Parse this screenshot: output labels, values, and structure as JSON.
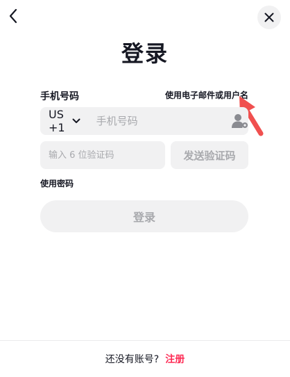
{
  "header": {
    "back_icon": "chevron-left-icon",
    "close_icon": "close-icon"
  },
  "title": "登录",
  "phone_section": {
    "label": "手机号码",
    "alt_login_link": "使用电子邮件或用户名",
    "country_code": "US +1",
    "phone_placeholder": "手机号码",
    "contact_icon": "contact-icon"
  },
  "code_section": {
    "code_placeholder": "输入 6 位验证码",
    "send_code_label": "发送验证码"
  },
  "password_link": "使用密码",
  "login_button": "登录",
  "footer": {
    "prompt": "还没有账号?",
    "register_label": "注册"
  },
  "colors": {
    "accent": "#fe2c55",
    "annotation_arrow": "#f0504f",
    "field_background": "#f1f1f2",
    "disabled_text": "#a8a9ad",
    "text": "#161823"
  }
}
